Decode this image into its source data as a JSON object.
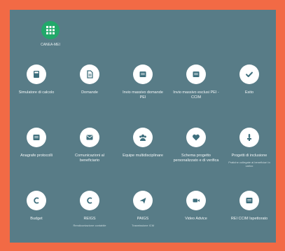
{
  "colors": {
    "frame": "#f26a45",
    "screen_bg": "#587c87",
    "top_app_circle": "#22a86a",
    "icon_circle": "#ffffff",
    "icon_glyph": "#3e6f7d"
  },
  "top_app": {
    "label": "CANEA-MEI",
    "icon": "grid-icon"
  },
  "tiles": [
    {
      "label": "Simulatore di calcolo",
      "sub": "",
      "icon": "calculator-icon"
    },
    {
      "label": "Domande",
      "sub": "",
      "icon": "document-icon"
    },
    {
      "label": "Invio massivo domande PEI",
      "sub": "",
      "icon": "list-icon"
    },
    {
      "label": "Invio massivo esclusi PEI - CCIM",
      "sub": "",
      "icon": "list-icon"
    },
    {
      "label": "Esito",
      "sub": "",
      "icon": "check-icon"
    },
    {
      "label": "Anagrafe protocolli",
      "sub": "",
      "icon": "list-icon"
    },
    {
      "label": "Comunicazioni al beneficiario",
      "sub": "",
      "icon": "mail-icon"
    },
    {
      "label": "Equipe multidisciplinare",
      "sub": "",
      "icon": "team-icon"
    },
    {
      "label": "Schema progetto personalizzato e di verifica",
      "sub": "",
      "icon": "heart-icon"
    },
    {
      "label": "Progetti di inclusione",
      "sub": "Pratiche collegate ai beneficiari in carico",
      "icon": "thumb-up-icon"
    },
    {
      "label": "Budget",
      "sub": "",
      "icon": "euro-icon"
    },
    {
      "label": "REIGS",
      "sub": "Rendicontazione contabile",
      "icon": "euro-icon"
    },
    {
      "label": "PAIGS",
      "sub": "Trasmissione ICM",
      "icon": "send-icon"
    },
    {
      "label": "Video Advice",
      "sub": "",
      "icon": "video-icon"
    },
    {
      "label": "REI CCIM Ispettorato",
      "sub": "",
      "icon": "list-icon"
    }
  ]
}
